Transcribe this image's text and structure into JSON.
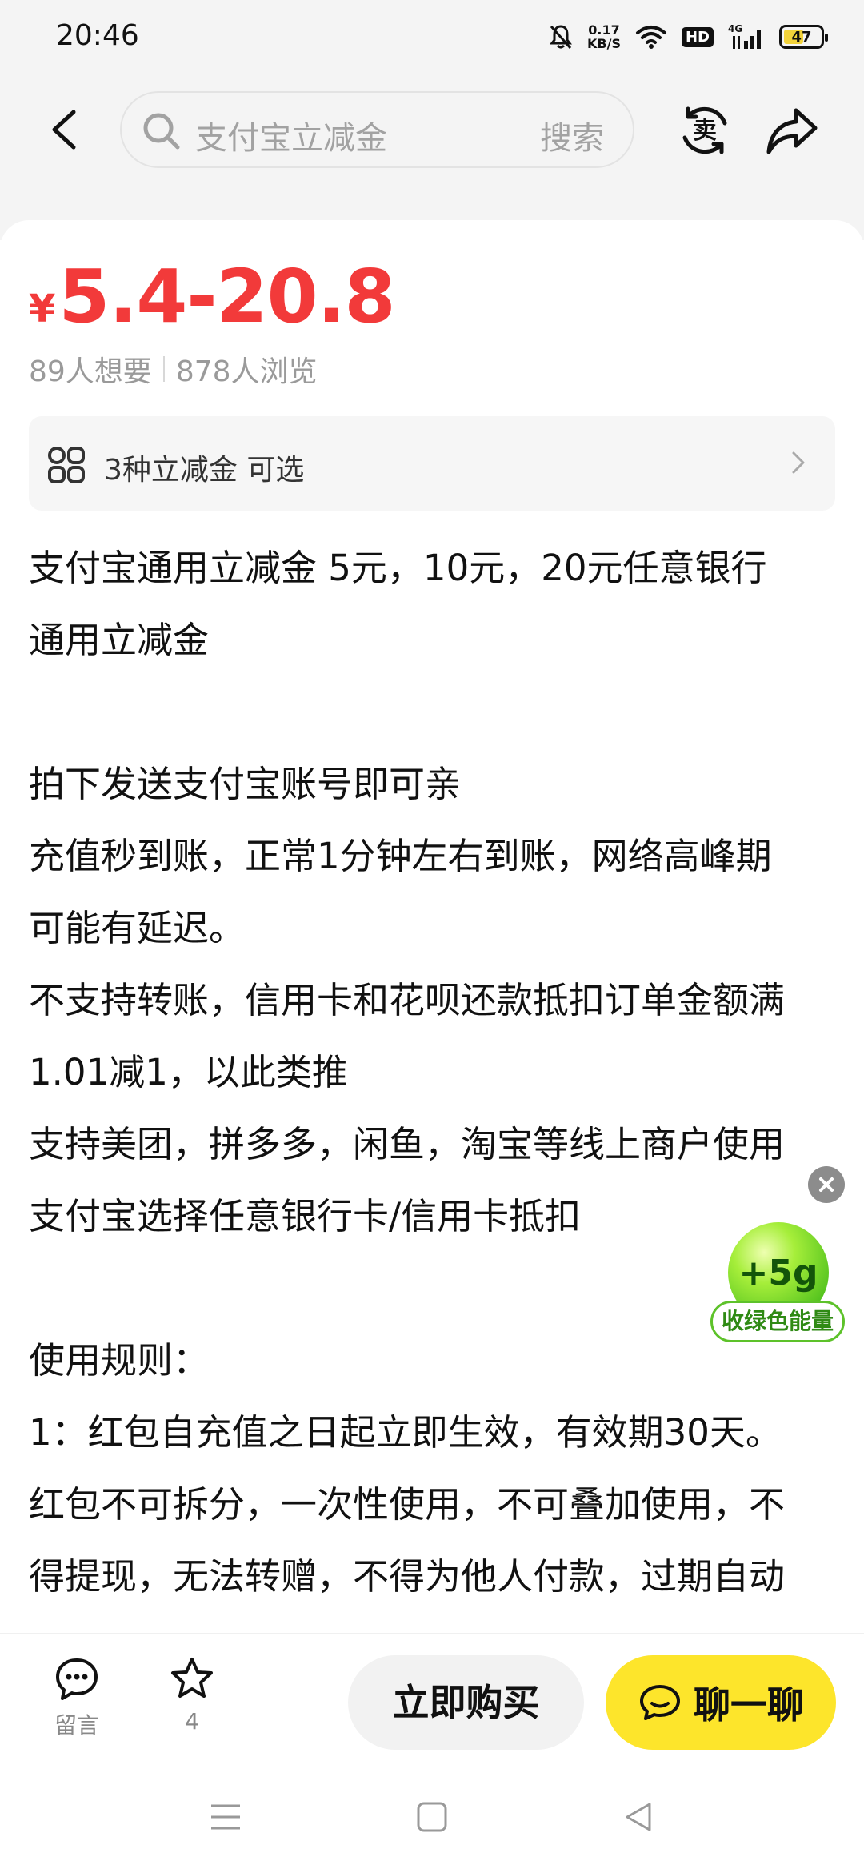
{
  "status_bar": {
    "time": "20:46",
    "net_speed_value": "0.17",
    "net_speed_unit": "KB/S",
    "hd": "HD",
    "network": "4G",
    "battery": "47",
    "battery_level": 0.47
  },
  "header": {
    "search_placeholder": "支付宝立减金",
    "search_button": "搜索",
    "icons": [
      "back-icon",
      "search-icon",
      "sell-icon",
      "share-icon"
    ]
  },
  "product": {
    "currency": "¥",
    "price": "5.4-20.8",
    "want_count": "89人想要",
    "view_count": "878人浏览",
    "coupon_option": "3种立减金 可选",
    "description": [
      "支付宝通用立减金 5元，10元，20元任意银行",
      "通用立减金",
      "",
      "拍下发送支付宝账号即可亲",
      "充值秒到账，正常1分钟左右到账，网络高峰期",
      "可能有延迟。",
      "不支持转账，信用卡和花呗还款抵扣订单金额满",
      "1.01减1，以此类推",
      "支持美团，拼多多，闲鱼，淘宝等线上商户使用",
      "支付宝选择任意银行卡/信用卡抵扣",
      "",
      "使用规则：",
      "1：红包自充值之日起立即生效，有效期30天。",
      "红包不可拆分，一次性使用，不可叠加使用，不",
      "得提现，无法转赠，不得为他人付款，过期自动"
    ]
  },
  "energy_widget": {
    "amount": "+5g",
    "label": "收绿色能量"
  },
  "bottom_bar": {
    "comment_label": "留言",
    "favorite_count": "4",
    "buy_label": "立即购买",
    "chat_label": "聊一聊"
  },
  "colors": {
    "price": "#f23a3a",
    "chat_button": "#fde52b",
    "energy_green": "#52c21e"
  }
}
